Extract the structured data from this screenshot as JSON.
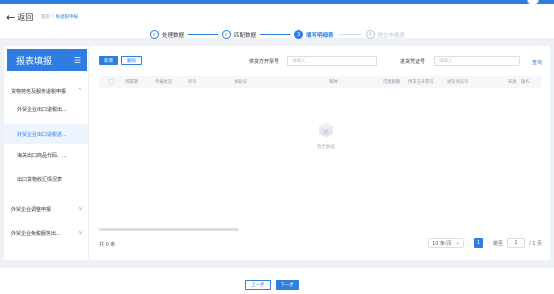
{
  "header": {
    "back_label": "返回",
    "breadcrumb": [
      "首页",
      "/",
      "免退税申报"
    ]
  },
  "steps": [
    {
      "label": "处理数据",
      "state": "done",
      "marker": "✓"
    },
    {
      "label": "匹配数据",
      "state": "done",
      "marker": "✓"
    },
    {
      "label": "填写明细表",
      "state": "active",
      "marker": "3"
    },
    {
      "label": "提交申报表",
      "state": "pending",
      "marker": "4"
    }
  ],
  "sidebar": {
    "title": "报表填报",
    "items": [
      {
        "label": "货物劳务及服务退税申报",
        "chevron": "^"
      },
      {
        "label": "外贸企业出口退税出...",
        "chevron": ""
      },
      {
        "label": "外贸企业出口退税进...",
        "chevron": ""
      },
      {
        "label": "海关出口商品代码、...",
        "chevron": ""
      },
      {
        "label": "出口货物收汇情况表",
        "chevron": ""
      },
      {
        "label": "外贸企业调整申报",
        "chevron": "v"
      },
      {
        "label": "外贸企业免税服务出...",
        "chevron": "v"
      }
    ]
  },
  "toolbar": {
    "add_label": "新增",
    "delete_label": "删除",
    "supplier_invoice_label": "供货方开票号",
    "supplier_invoice_placeholder": "请输入",
    "voucher_label": "进货凭证号",
    "voucher_placeholder": "请输入",
    "query_label": "查询"
  },
  "table": {
    "columns": [
      "所属期",
      "申报批次",
      "序号",
      "关联号",
      "税种",
      "可退税额",
      "供货方开票号",
      "进货凭证号",
      "开具",
      "操作"
    ],
    "empty_text": "暂无数据",
    "rows": []
  },
  "pagination": {
    "total_text": "共 0 条",
    "page_size": "10 条/页",
    "current_page": "1",
    "jump_prefix": "跳至",
    "jump_value": "1",
    "jump_suffix": "/ 1 页"
  },
  "footer": {
    "prev_label": "上一步",
    "next_label": "下一步"
  },
  "colors": {
    "accent": "#2f7de1",
    "page_bg": "#eef1f5"
  }
}
